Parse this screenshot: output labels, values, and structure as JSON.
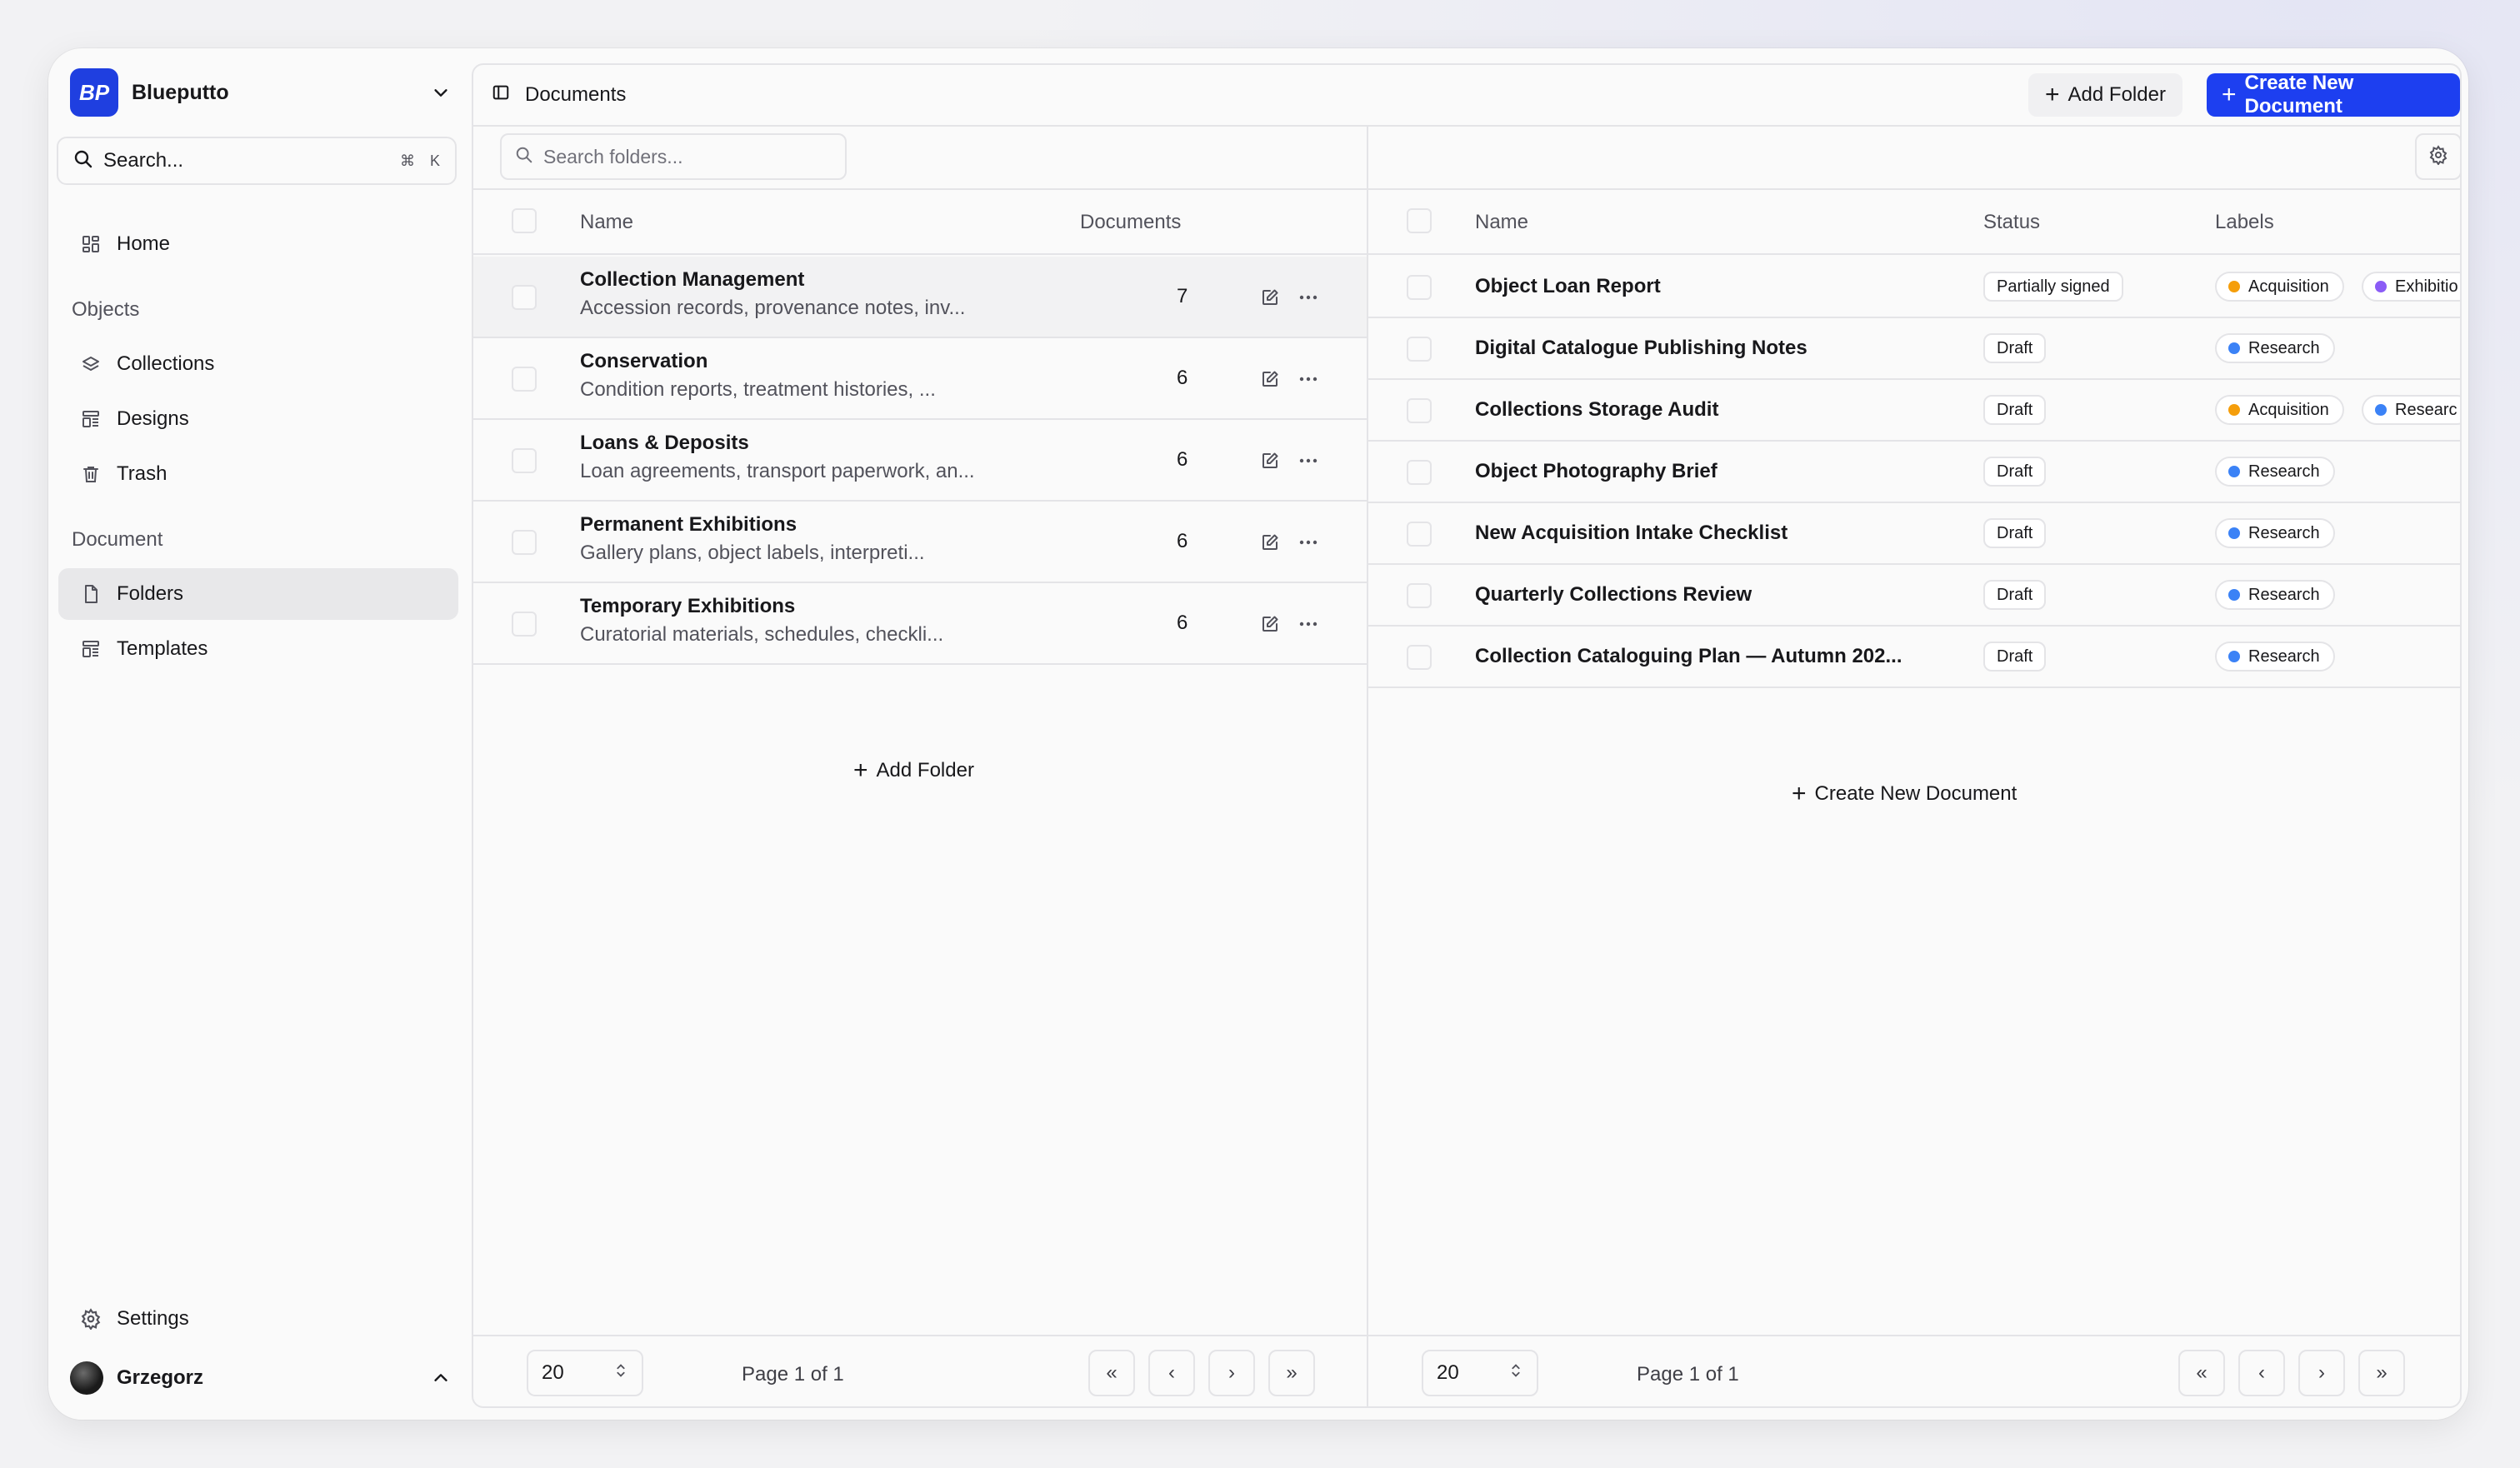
{
  "sidebar": {
    "brand": {
      "logo_text": "BP",
      "name": "Blueputto"
    },
    "search": {
      "label": "Search...",
      "shortcut_cmd": "⌘",
      "shortcut_key": "K"
    },
    "home": "Home",
    "objects_heading": "Objects",
    "objects": [
      "Collections",
      "Designs",
      "Trash"
    ],
    "document_heading": "Document",
    "documents": [
      "Folders",
      "Templates"
    ],
    "settings": "Settings",
    "user": "Grzegorz"
  },
  "header": {
    "title": "Documents",
    "add_folder": "Add Folder",
    "create_document": "Create New Document"
  },
  "folders": {
    "search_placeholder": "Search folders...",
    "columns": {
      "name": "Name",
      "documents": "Documents"
    },
    "rows": [
      {
        "name": "Collection Management",
        "description": "Accession records, provenance notes, inv...",
        "count": "7"
      },
      {
        "name": "Conservation",
        "description": "Condition reports, treatment histories, ...",
        "count": "6"
      },
      {
        "name": "Loans & Deposits",
        "description": "Loan agreements, transport paperwork, an...",
        "count": "6"
      },
      {
        "name": "Permanent Exhibitions",
        "description": "Gallery plans, object labels, interpreti...",
        "count": "6"
      },
      {
        "name": "Temporary Exhibitions",
        "description": "Curatorial materials, schedules, checkli...",
        "count": "6"
      }
    ],
    "add_label": "Add Folder",
    "page_size": "20",
    "page_info": "Page 1 of 1"
  },
  "documents": {
    "columns": {
      "name": "Name",
      "status": "Status",
      "labels": "Labels"
    },
    "rows": [
      {
        "name": "Object Loan Report",
        "status": "Partially signed",
        "labels": [
          {
            "text": "Acquisition",
            "color": "#f59e0b"
          },
          {
            "text": "Exhibitio",
            "color": "#8b5cf6"
          }
        ]
      },
      {
        "name": "Digital Catalogue Publishing Notes",
        "status": "Draft",
        "labels": [
          {
            "text": "Research",
            "color": "#3b82f6"
          }
        ]
      },
      {
        "name": "Collections Storage Audit",
        "status": "Draft",
        "labels": [
          {
            "text": "Acquisition",
            "color": "#f59e0b"
          },
          {
            "text": "Researc",
            "color": "#3b82f6"
          }
        ]
      },
      {
        "name": "Object Photography Brief",
        "status": "Draft",
        "labels": [
          {
            "text": "Research",
            "color": "#3b82f6"
          }
        ]
      },
      {
        "name": "New Acquisition Intake Checklist",
        "status": "Draft",
        "labels": [
          {
            "text": "Research",
            "color": "#3b82f6"
          }
        ]
      },
      {
        "name": "Quarterly Collections Review",
        "status": "Draft",
        "labels": [
          {
            "text": "Research",
            "color": "#3b82f6"
          }
        ]
      },
      {
        "name": "Collection Cataloguing Plan — Autumn 202...",
        "status": "Draft",
        "labels": [
          {
            "text": "Research",
            "color": "#3b82f6"
          }
        ]
      }
    ],
    "add_label": "Create New Document",
    "page_size": "20",
    "page_info": "Page 1 of 1"
  },
  "pagination": {
    "first": "«",
    "prev": "‹",
    "next": "›",
    "last": "»"
  },
  "colors": {
    "primary": "#1d3ff0",
    "brand": "#1f3fe0",
    "border": "#e4e4e7"
  }
}
